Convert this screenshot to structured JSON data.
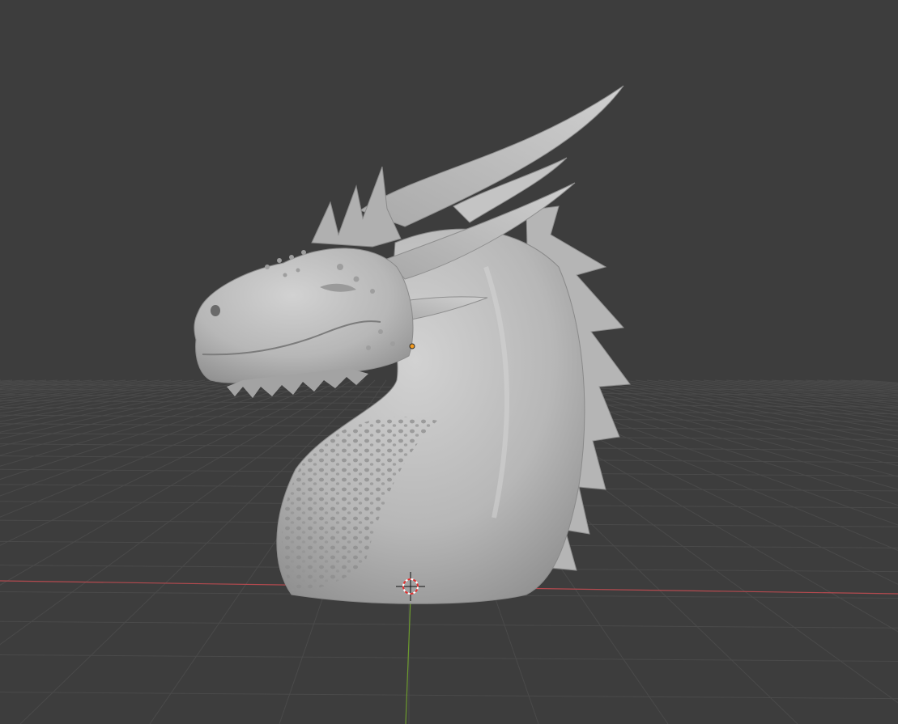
{
  "viewport": {
    "view": "3D Viewport",
    "background_color": "#3d3d3d",
    "grid_color": "#4d4d4d",
    "x_axis_color": "#b44a4f",
    "y_axis_color": "#6c9a2e",
    "model": "dragon-head-sculpt",
    "model_color": "#bdbdbd",
    "origin_color": "#f39b20",
    "cursor": "3d-cursor-icon"
  }
}
